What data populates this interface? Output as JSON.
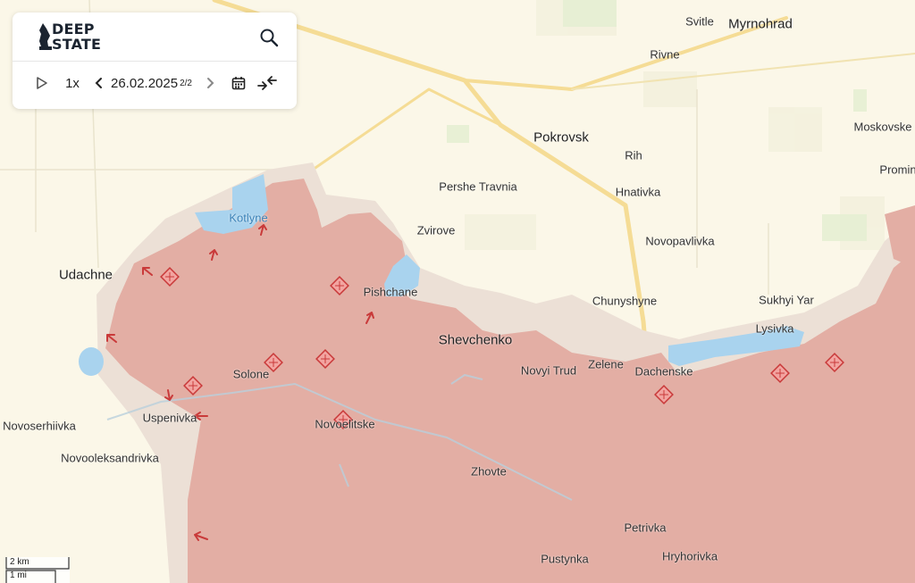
{
  "app": {
    "logo_lines": [
      "DEEP",
      "STATE"
    ],
    "search_icon": "search-icon"
  },
  "timeline": {
    "speed": "1x",
    "date": "26.02.2025",
    "date_index": "2/2",
    "icons": [
      "play-icon",
      "chevron-left-icon",
      "chevron-right-icon",
      "calendar-icon",
      "compress-arrows-icon"
    ]
  },
  "map": {
    "colors": {
      "background": "#fbf7e8",
      "occupied": "#e3aea4",
      "contested": "#ece0d6",
      "water": "#a9d3ee",
      "roads": "#f5dc95",
      "marker": "#d63a3a"
    },
    "places": [
      {
        "id": "mirnohrad",
        "name": "Myrnohrad"
      },
      {
        "id": "svitle",
        "name": "Svitle"
      },
      {
        "id": "rivne",
        "name": "Rivne"
      },
      {
        "id": "pokrovsk",
        "name": "Pokrovsk"
      },
      {
        "id": "moskovske",
        "name": "Moskovske"
      },
      {
        "id": "rih",
        "name": "Rih"
      },
      {
        "id": "promin",
        "name": "Promin"
      },
      {
        "id": "pershe-travnia",
        "name": "Pershe Travnia"
      },
      {
        "id": "hnativka",
        "name": "Hnativka"
      },
      {
        "id": "kotlyne",
        "name": "Kotlyne"
      },
      {
        "id": "zvirove",
        "name": "Zvirove"
      },
      {
        "id": "novopavlivka",
        "name": "Novopavlivka"
      },
      {
        "id": "udachne",
        "name": "Udachne"
      },
      {
        "id": "pishchane",
        "name": "Pishchane"
      },
      {
        "id": "chunyshyne",
        "name": "Chunyshyne"
      },
      {
        "id": "sukhyi-yar",
        "name": "Sukhyi Yar"
      },
      {
        "id": "lysivka",
        "name": "Lysivka"
      },
      {
        "id": "shevchenko",
        "name": "Shevchenko"
      },
      {
        "id": "zelene",
        "name": "Zelene"
      },
      {
        "id": "novyi-trud",
        "name": "Novyi Trud"
      },
      {
        "id": "dachenske",
        "name": "Dachenske"
      },
      {
        "id": "solone",
        "name": "Solone"
      },
      {
        "id": "uspenivka",
        "name": "Uspenivka"
      },
      {
        "id": "novoselytske",
        "name": "Novoelitske"
      },
      {
        "id": "novoserhiivka",
        "name": "Novoserhiivka"
      },
      {
        "id": "novooleksandrivka",
        "name": "Novooleksandrivka"
      },
      {
        "id": "zhovte",
        "name": "Zhovte"
      },
      {
        "id": "petrivka",
        "name": "Petrivka"
      },
      {
        "id": "pustynka",
        "name": "Pustynka"
      },
      {
        "id": "hryhorivka",
        "name": "Hryhorivka"
      }
    ]
  },
  "scale": {
    "km": "2 km",
    "mi": "1 mi"
  }
}
